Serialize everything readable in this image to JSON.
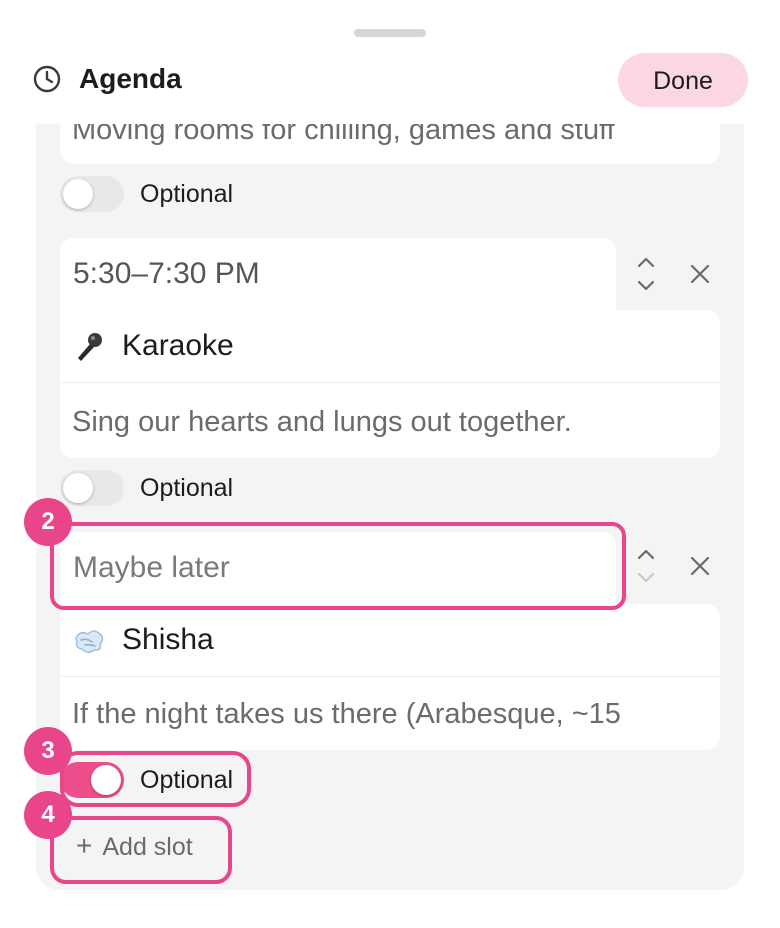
{
  "header": {
    "title": "Agenda",
    "done_label": "Done"
  },
  "slots": [
    {
      "description": "Moving rooms for chilling, games and stuff",
      "optional_label": "Optional",
      "optional_on": false
    },
    {
      "time": "5:30–7:30 PM",
      "title_emoji_icon": "microphone-icon",
      "title": "Karaoke",
      "description": "Sing our hearts and lungs out together.",
      "optional_label": "Optional",
      "optional_on": false
    },
    {
      "time_placeholder": "Maybe later",
      "title_emoji_icon": "dash-cloud-icon",
      "title": "Shisha",
      "description": "If the night takes us there (Arabesque, ~15",
      "optional_label": "Optional",
      "optional_on": true
    }
  ],
  "add_slot_label": "Add slot",
  "annotations": [
    "2",
    "3",
    "4"
  ],
  "colors": {
    "accent_pink": "#e8458a",
    "done_button_bg": "#fbd7e4",
    "toggle_on": "#ec4f8c",
    "panel_bg": "#f4f4f4"
  }
}
